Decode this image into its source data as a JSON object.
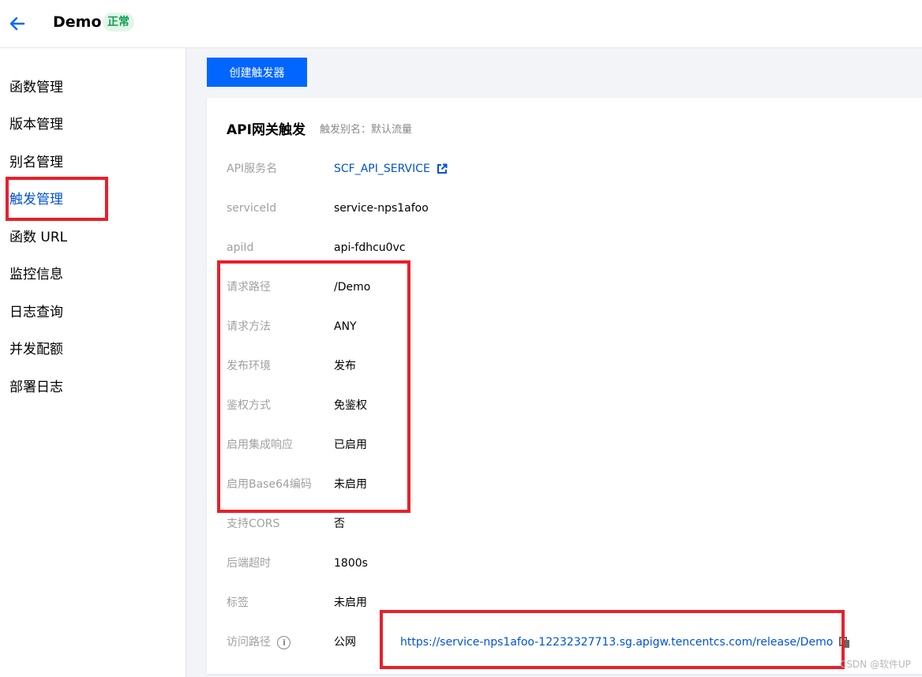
{
  "header": {
    "title": "Demo",
    "status_badge": "正常"
  },
  "sidebar": {
    "items": [
      {
        "label": "函数管理"
      },
      {
        "label": "版本管理"
      },
      {
        "label": "别名管理"
      },
      {
        "label": "触发管理",
        "active": true
      },
      {
        "label": "函数 URL"
      },
      {
        "label": "监控信息"
      },
      {
        "label": "日志查询"
      },
      {
        "label": "并发配额"
      },
      {
        "label": "部署日志"
      }
    ]
  },
  "toolbar": {
    "create_trigger_label": "创建触发器"
  },
  "trigger": {
    "title": "API网关触发",
    "alias_label": "触发别名：默认流量",
    "rows": [
      {
        "label": "API服务名",
        "value": "SCF_API_SERVICE"
      },
      {
        "label": "serviceId",
        "value": "service-nps1afoo"
      },
      {
        "label": "apiId",
        "value": "api-fdhcu0vc"
      },
      {
        "label": "请求路径",
        "value": "/Demo"
      },
      {
        "label": "请求方法",
        "value": "ANY"
      },
      {
        "label": "发布环境",
        "value": "发布"
      },
      {
        "label": "鉴权方式",
        "value": "免鉴权"
      },
      {
        "label": "启用集成响应",
        "value": "已启用"
      },
      {
        "label": "启用Base64编码",
        "value": "未启用"
      },
      {
        "label": "支持CORS",
        "value": "否"
      },
      {
        "label": "后端超时",
        "value": "1800s"
      },
      {
        "label": "标签",
        "value": "未启用"
      },
      {
        "label": "访问路径",
        "value": "公网"
      }
    ],
    "access_url": "https://service-nps1afoo-12232327713.sg.apigw.tencentcs.com/release/Demo"
  },
  "watermark": "CSDN @软件UP",
  "colors": {
    "accent": "#0052d9",
    "button": "#0066ff",
    "status_green": "#0a9f4f",
    "annotation_red": "#e8202a"
  }
}
